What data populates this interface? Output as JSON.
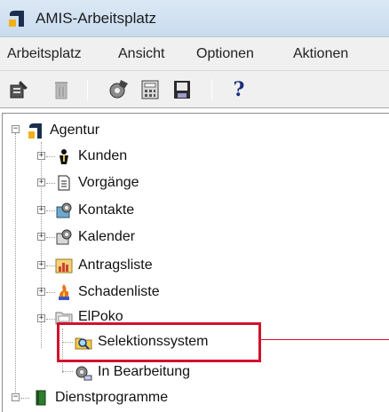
{
  "window": {
    "title": "AMIS-Arbeitsplatz"
  },
  "menubar": {
    "items": [
      "Arbeitsplatz",
      "Ansicht",
      "Optionen",
      "Aktionen"
    ]
  },
  "toolbar": {
    "buttons": [
      "properties-icon",
      "trash-icon",
      "agent-settings-icon",
      "calculator-icon",
      "disk-icon",
      "help-icon"
    ],
    "help_label": "?"
  },
  "tree": {
    "root": {
      "label": "Agentur",
      "expanded": true
    },
    "items": [
      {
        "label": "Kunden",
        "icon": "person-icon"
      },
      {
        "label": "Vorgänge",
        "icon": "document-icon"
      },
      {
        "label": "Kontakte",
        "icon": "contacts-icon"
      },
      {
        "label": "Kalender",
        "icon": "calendar-icon"
      },
      {
        "label": "Antragsliste",
        "icon": "chart-icon"
      },
      {
        "label": "Schadenliste",
        "icon": "fire-icon"
      },
      {
        "label": "ElPoko",
        "icon": "folder-icon"
      },
      {
        "label": "Selektionssystem",
        "icon": "search-icon",
        "highlighted": true
      },
      {
        "label": "In Bearbeitung",
        "icon": "processing-icon"
      }
    ],
    "second_root": {
      "label": "Dienstprogramme",
      "expanded": true
    },
    "expander_plus": "+",
    "expander_minus": "−"
  },
  "colors": {
    "highlight": "#d2112d",
    "titlebar": "#c9dbee"
  }
}
